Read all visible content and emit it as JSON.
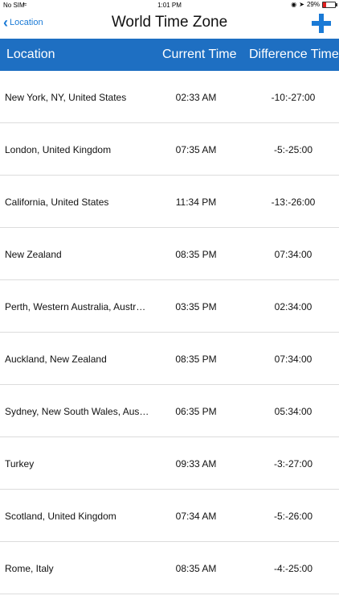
{
  "status_bar": {
    "carrier": "No SIM",
    "time": "1:01 PM",
    "battery": "29%",
    "battery_level": 0.29
  },
  "nav": {
    "back_label": "Location",
    "title": "World Time Zone"
  },
  "columns": {
    "location": "Location",
    "current_time": "Current Time",
    "difference_time": "Difference Time"
  },
  "rows": [
    {
      "location": "New York, NY, United States",
      "current": "02:33 AM",
      "difference": "-10:-27:00"
    },
    {
      "location": "London, United Kingdom",
      "current": "07:35 AM",
      "difference": "-5:-25:00"
    },
    {
      "location": "California, United States",
      "current": "11:34 PM",
      "difference": "-13:-26:00"
    },
    {
      "location": "New Zealand",
      "current": "08:35 PM",
      "difference": "07:34:00"
    },
    {
      "location": "Perth, Western Australia, Australia",
      "current": "03:35 PM",
      "difference": "02:34:00"
    },
    {
      "location": "Auckland, New Zealand",
      "current": "08:35 PM",
      "difference": "07:34:00"
    },
    {
      "location": "Sydney, New South Wales, Austr...",
      "current": "06:35 PM",
      "difference": "05:34:00"
    },
    {
      "location": "Turkey",
      "current": "09:33 AM",
      "difference": "-3:-27:00"
    },
    {
      "location": "Scotland, United Kingdom",
      "current": "07:34 AM",
      "difference": "-5:-26:00"
    },
    {
      "location": "Rome, Italy",
      "current": "08:35 AM",
      "difference": "-4:-25:00"
    }
  ],
  "colors": {
    "accent": "#1a7ad6",
    "header_bg": "#1e6fc2"
  }
}
